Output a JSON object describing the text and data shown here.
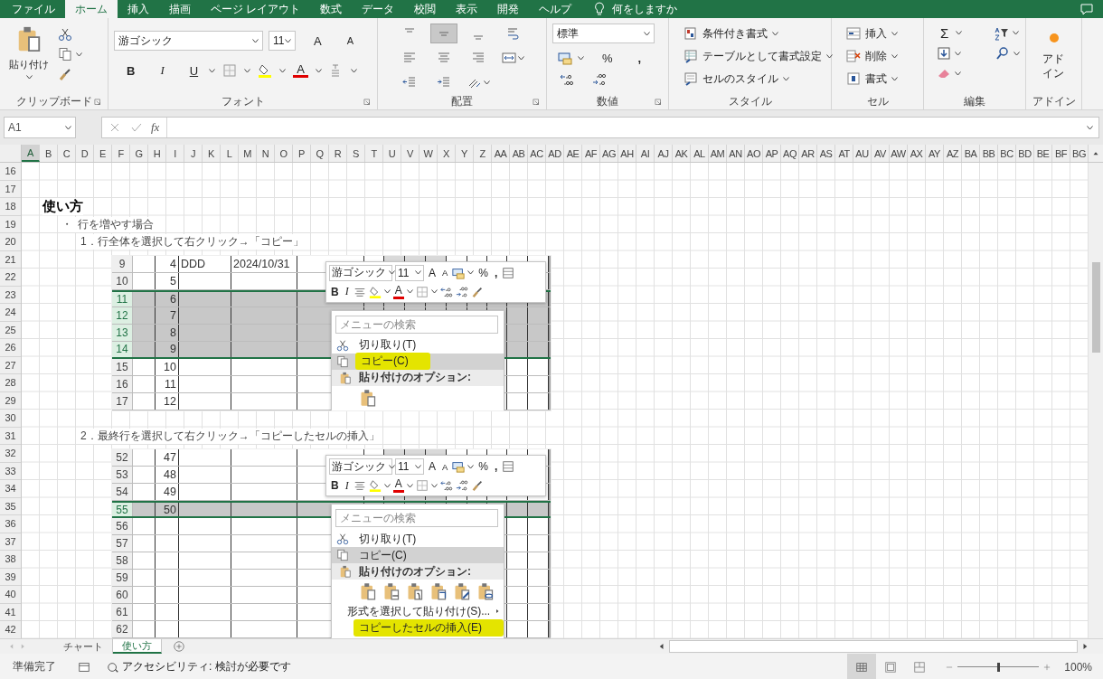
{
  "menu_tabs": [
    {
      "label": "ファイル",
      "selected": false
    },
    {
      "label": "ホーム",
      "selected": true
    },
    {
      "label": "挿入",
      "selected": false
    },
    {
      "label": "描画",
      "selected": false
    },
    {
      "label": "ページ レイアウト",
      "selected": false
    },
    {
      "label": "数式",
      "selected": false
    },
    {
      "label": "データ",
      "selected": false
    },
    {
      "label": "校閲",
      "selected": false
    },
    {
      "label": "表示",
      "selected": false
    },
    {
      "label": "開発",
      "selected": false
    },
    {
      "label": "ヘルプ",
      "selected": false
    }
  ],
  "tell_me": "何をしますか",
  "ribbon": {
    "clipboard": {
      "paste": "貼り付け",
      "label": "クリップボード"
    },
    "font": {
      "name": "游ゴシック",
      "size": "11",
      "grow": "A",
      "shrink": "A",
      "bold": "B",
      "italic": "I",
      "underline": "U",
      "color_letter": "A",
      "label": "フォント"
    },
    "alignment": {
      "label": "配置",
      "buttons": [
        {
          "kind": "top",
          "on": false
        },
        {
          "kind": "middle",
          "on": true
        },
        {
          "kind": "bottom",
          "on": false
        },
        {
          "kind": "wrap",
          "on": false
        },
        {
          "kind": "left",
          "on": false
        },
        {
          "kind": "center",
          "on": false
        },
        {
          "kind": "right",
          "on": false
        },
        {
          "kind": "merge",
          "on": false
        },
        {
          "kind": "indent-decrease",
          "on": false
        },
        {
          "kind": "indent-increase",
          "on": false
        },
        {
          "kind": "orientation",
          "on": false
        }
      ]
    },
    "number": {
      "format": "標準",
      "percent": "%",
      "comma": ",",
      "label": "数値"
    },
    "styles": {
      "items": [
        "条件付き書式",
        "テーブルとして書式設定",
        "セルのスタイル"
      ],
      "label": "スタイル"
    },
    "cells": {
      "items": [
        "挿入",
        "削除",
        "書式"
      ],
      "label": "セル"
    },
    "editing": {
      "sum": "Σ",
      "label": "編集"
    },
    "addins": {
      "button": "アドイン",
      "label": "アドイン"
    }
  },
  "formula_bar": {
    "name_box": "A1",
    "fx": "fx"
  },
  "columns": [
    {
      "label": "A",
      "selected": true
    },
    {
      "label": "B",
      "selected": false
    },
    {
      "label": "C",
      "selected": false
    },
    {
      "label": "D",
      "selected": false
    },
    {
      "label": "E",
      "selected": false
    },
    {
      "label": "F",
      "selected": false
    },
    {
      "label": "G",
      "selected": false
    },
    {
      "label": "H",
      "selected": false
    },
    {
      "label": "I",
      "selected": false
    },
    {
      "label": "J",
      "selected": false
    },
    {
      "label": "K",
      "selected": false
    },
    {
      "label": "L",
      "selected": false
    },
    {
      "label": "M",
      "selected": false
    },
    {
      "label": "N",
      "selected": false
    },
    {
      "label": "O",
      "selected": false
    },
    {
      "label": "P",
      "selected": false
    },
    {
      "label": "Q",
      "selected": false
    },
    {
      "label": "R",
      "selected": false
    },
    {
      "label": "S",
      "selected": false
    },
    {
      "label": "T",
      "selected": false
    },
    {
      "label": "U",
      "selected": false
    },
    {
      "label": "V",
      "selected": false
    },
    {
      "label": "W",
      "selected": false
    },
    {
      "label": "X",
      "selected": false
    },
    {
      "label": "Y",
      "selected": false
    },
    {
      "label": "Z",
      "selected": false
    },
    {
      "label": "AA",
      "selected": false
    },
    {
      "label": "AB",
      "selected": false
    },
    {
      "label": "AC",
      "selected": false
    },
    {
      "label": "AD",
      "selected": false
    },
    {
      "label": "AE",
      "selected": false
    },
    {
      "label": "AF",
      "selected": false
    },
    {
      "label": "AG",
      "selected": false
    },
    {
      "label": "AH",
      "selected": false
    },
    {
      "label": "AI",
      "selected": false
    },
    {
      "label": "AJ",
      "selected": false
    },
    {
      "label": "AK",
      "selected": false
    },
    {
      "label": "AL",
      "selected": false
    },
    {
      "label": "AM",
      "selected": false
    },
    {
      "label": "AN",
      "selected": false
    },
    {
      "label": "AO",
      "selected": false
    },
    {
      "label": "AP",
      "selected": false
    },
    {
      "label": "AQ",
      "selected": false
    },
    {
      "label": "AR",
      "selected": false
    },
    {
      "label": "AS",
      "selected": false
    },
    {
      "label": "AT",
      "selected": false
    },
    {
      "label": "AU",
      "selected": false
    },
    {
      "label": "AV",
      "selected": false
    },
    {
      "label": "AW",
      "selected": false
    },
    {
      "label": "AX",
      "selected": false
    },
    {
      "label": "AY",
      "selected": false
    },
    {
      "label": "AZ",
      "selected": false
    },
    {
      "label": "BA",
      "selected": false
    },
    {
      "label": "BB",
      "selected": false
    },
    {
      "label": "BC",
      "selected": false
    },
    {
      "label": "BD",
      "selected": false
    },
    {
      "label": "BE",
      "selected": false
    },
    {
      "label": "BF",
      "selected": false
    },
    {
      "label": "BG",
      "selected": false
    }
  ],
  "sheet_rows": [
    {
      "number": "16"
    },
    {
      "number": "17"
    },
    {
      "number": "18",
      "kind": "heading",
      "text": "使い方"
    },
    {
      "number": "19",
      "kind": "bullet",
      "bullet": "・",
      "text": "行を増やす場合"
    },
    {
      "number": "20",
      "kind": "step",
      "text": "1．行全体を選択して右クリック→「コピー」"
    },
    {
      "number": "21",
      "kind": "picture",
      "picture": {
        "rows": [
          {
            "number": "9",
            "selected": false,
            "cells": [
              "4",
              "DDD",
              "2024/10/31"
            ]
          },
          {
            "number": "10",
            "selected": false,
            "cells": [
              "5"
            ]
          },
          {
            "number": "11",
            "selected": true,
            "cells": [
              "6"
            ]
          },
          {
            "number": "12",
            "selected": true,
            "cells": [
              "7"
            ]
          },
          {
            "number": "13",
            "selected": true,
            "cells": [
              "8"
            ]
          },
          {
            "number": "14",
            "selected": true,
            "cells": [
              "9"
            ]
          },
          {
            "number": "15",
            "selected": false,
            "cells": [
              "10"
            ]
          },
          {
            "number": "16",
            "selected": false,
            "cells": [
              "11"
            ]
          },
          {
            "number": "17",
            "selected": false,
            "cells": [
              "12"
            ]
          }
        ],
        "toolbar": {
          "font": "游ゴシック",
          "size": "11",
          "grow": "A",
          "shrink": "A",
          "percent": "%",
          "comma": ",",
          "bold": "B",
          "italic": "I",
          "color_letter": "A"
        },
        "menu": {
          "search_placeholder": "メニューの検索",
          "items": [
            {
              "kind": "cut",
              "label": "切り取り(T)",
              "hovered": false,
              "marked": false
            },
            {
              "kind": "copy",
              "label": "コピー(C)",
              "hovered": true,
              "marked": true
            },
            {
              "kind": "header",
              "label": "貼り付けのオプション:"
            },
            {
              "kind": "paste-options",
              "options": [
                {
                  "kind": "paste"
                }
              ]
            }
          ]
        }
      }
    },
    {
      "number": "22"
    },
    {
      "number": "23"
    },
    {
      "number": "24"
    },
    {
      "number": "25"
    },
    {
      "number": "26"
    },
    {
      "number": "27"
    },
    {
      "number": "28"
    },
    {
      "number": "29"
    },
    {
      "number": "30"
    },
    {
      "number": "31",
      "kind": "step",
      "text": "2．最終行を選択して右クリック→「コピーしたセルの挿入」"
    },
    {
      "number": "32",
      "kind": "picture",
      "picture": {
        "rows": [
          {
            "number": "52",
            "selected": false,
            "cells": [
              "47"
            ]
          },
          {
            "number": "53",
            "selected": false,
            "cells": [
              "48"
            ]
          },
          {
            "number": "54",
            "selected": false,
            "cells": [
              "49"
            ]
          },
          {
            "number": "55",
            "selected": true,
            "cells": [
              "50"
            ]
          },
          {
            "number": "56",
            "selected": false,
            "cells": []
          },
          {
            "number": "57",
            "selected": false,
            "cells": []
          },
          {
            "number": "58",
            "selected": false,
            "cells": []
          },
          {
            "number": "59",
            "selected": false,
            "cells": []
          },
          {
            "number": "60",
            "selected": false,
            "cells": []
          },
          {
            "number": "61",
            "selected": false,
            "cells": []
          },
          {
            "number": "62",
            "selected": false,
            "cells": []
          }
        ],
        "toolbar": {
          "font": "游ゴシック",
          "size": "11",
          "grow": "A",
          "shrink": "A",
          "percent": "%",
          "comma": ",",
          "bold": "B",
          "italic": "I",
          "color_letter": "A"
        },
        "menu": {
          "search_placeholder": "メニューの検索",
          "items": [
            {
              "kind": "cut",
              "label": "切り取り(T)",
              "hovered": false,
              "marked": false
            },
            {
              "kind": "copy",
              "label": "コピー(C)",
              "hovered": true,
              "marked": false
            },
            {
              "kind": "header",
              "label": "貼り付けのオプション:"
            },
            {
              "kind": "paste-options",
              "options": [
                {
                  "kind": "paste"
                },
                {
                  "kind": "values"
                },
                {
                  "kind": "formulas"
                },
                {
                  "kind": "transpose"
                },
                {
                  "kind": "formatting"
                },
                {
                  "kind": "link"
                }
              ]
            },
            {
              "kind": "command",
              "label": "形式を選択して貼り付け(S)...",
              "submenu": true,
              "hovered": false,
              "marked": false
            },
            {
              "kind": "command",
              "label": "コピーしたセルの挿入(E)",
              "submenu": false,
              "hovered": false,
              "marked": true
            }
          ]
        }
      }
    },
    {
      "number": "33"
    },
    {
      "number": "34"
    },
    {
      "number": "35"
    },
    {
      "number": "36"
    },
    {
      "number": "37"
    },
    {
      "number": "38"
    },
    {
      "number": "39"
    },
    {
      "number": "40"
    },
    {
      "number": "41"
    },
    {
      "number": "42"
    }
  ],
  "sheet_tabs": [
    {
      "label": "チャート",
      "selected": false
    },
    {
      "label": "使い方",
      "selected": true
    }
  ],
  "status_bar": {
    "ready": "準備完了",
    "accessibility": "アクセシビリティ: 検討が必要です",
    "views": [
      {
        "kind": "normal",
        "selected": true
      },
      {
        "kind": "page-layout",
        "selected": false
      },
      {
        "kind": "page-break",
        "selected": false
      }
    ],
    "zoom": {
      "level": 0.5
    },
    "zoom_text": "100%"
  }
}
